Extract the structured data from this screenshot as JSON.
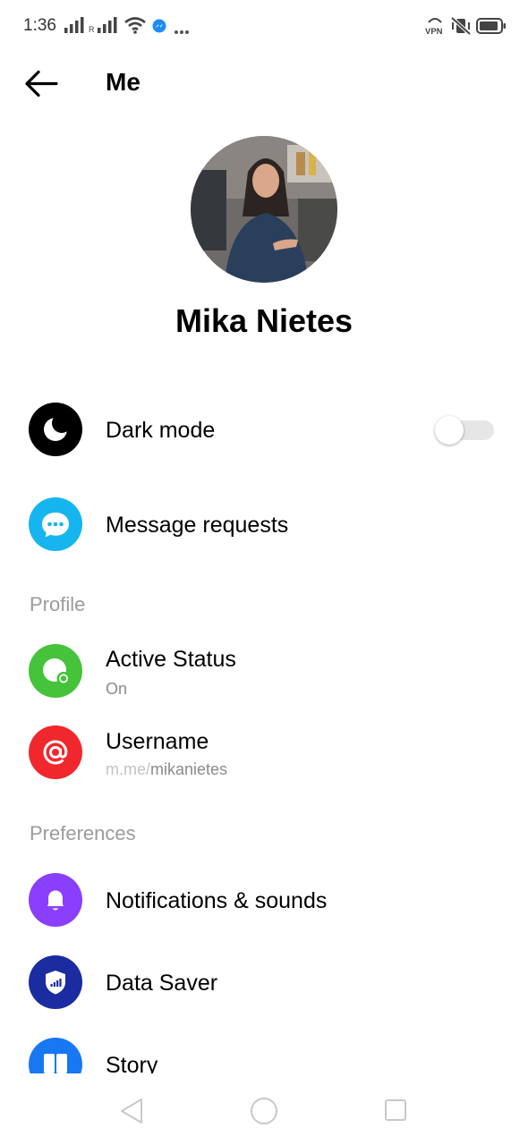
{
  "status_bar": {
    "time": "1:36",
    "icons": [
      "signal-icon",
      "roaming-signal-icon",
      "wifi-icon",
      "messenger-icon",
      "more-icon",
      "vpn-icon",
      "mute-icon",
      "battery-icon"
    ],
    "vpn_label": "VPN",
    "roaming_label": "R"
  },
  "header": {
    "title": "Me",
    "back_icon": "arrow-left-icon"
  },
  "profile": {
    "name": "Mika Nietes"
  },
  "settings": {
    "dark_mode": {
      "label": "Dark mode",
      "icon": "moon-icon",
      "color": "#000000",
      "enabled": false
    },
    "message_requests": {
      "label": "Message requests",
      "icon": "chat-bubble-icon",
      "color": "#16b5f0"
    }
  },
  "profile_section": {
    "title": "Profile",
    "active_status": {
      "label": "Active Status",
      "value": "On",
      "icon": "active-status-icon",
      "color": "#45c33a"
    },
    "username": {
      "label": "Username",
      "domain": "m.me/",
      "handle": "mikanietes",
      "icon": "at-sign-icon",
      "color": "#f0282d"
    }
  },
  "preferences_section": {
    "title": "Preferences",
    "notifications": {
      "label": "Notifications & sounds",
      "icon": "bell-icon",
      "color": "#8a3ffc"
    },
    "data_saver": {
      "label": "Data Saver",
      "icon": "shield-icon",
      "color": "#1b2ba0"
    },
    "story": {
      "label": "Story",
      "icon": "story-icon",
      "color": "#1877f2"
    }
  },
  "nav_bar": {
    "buttons": [
      "back-triangle-icon",
      "home-circle-icon",
      "recents-square-icon"
    ]
  }
}
